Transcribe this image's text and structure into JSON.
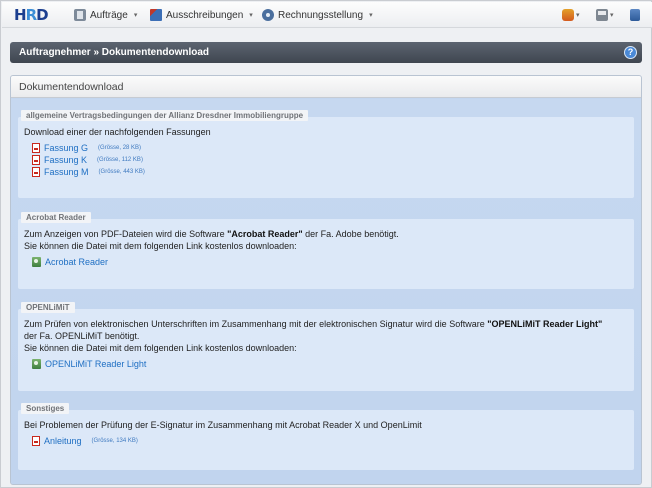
{
  "nav": {
    "logo": {
      "h": "H",
      "r": "R",
      "d": "D"
    },
    "items": [
      {
        "label": "Aufträge",
        "icon": "orders-icon"
      },
      {
        "label": "Ausschreibungen",
        "icon": "tender-icon"
      },
      {
        "label": "Rechnungsstellung",
        "icon": "billing-icon"
      }
    ],
    "caret": "▾",
    "right_icons": [
      "user-icon",
      "print-icon",
      "logout-icon"
    ]
  },
  "header": {
    "title": "Auftragnehmer » Dokumentendownload",
    "help": "?"
  },
  "panel": {
    "title": "Dokumentendownload",
    "sections": [
      {
        "legend": "allgemeine Vertragsbedingungen der Allianz Dresdner Immobiliengruppe",
        "text": "Download einer der nachfolgenden Fassungen",
        "links": [
          {
            "label": "Fassung G",
            "size": "(Grösse, 28 KB)"
          },
          {
            "label": "Fassung K",
            "size": "(Grösse, 112 KB)"
          },
          {
            "label": "Fassung M",
            "size": "(Grösse, 443 KB)"
          }
        ]
      },
      {
        "legend": "Acrobat Reader",
        "line1_pre": "Zum Anzeigen von PDF-Dateien wird die Software ",
        "line1_bold": "\"Acrobat Reader\"",
        "line1_post": " der Fa. Adobe benötigt.",
        "line2": "Sie können die Datei mit dem folgenden Link kostenlos downloaden:",
        "link": "Acrobat Reader"
      },
      {
        "legend": "OPENLiMiT",
        "line1_pre": "Zum Prüfen von elektronischen Unterschriften im Zusammenhang mit der elektronischen Signatur wird die Software ",
        "line1_bold": "\"OPENLiMiT Reader Light\"",
        "line2": "der Fa. OPENLiMiT benötigt.",
        "line3": "Sie können die Datei mit dem folgenden Link kostenlos downloaden:",
        "link": "OPENLiMiT Reader Light"
      },
      {
        "legend": "Sonstiges",
        "text": "Bei Problemen der Prüfung der E-Signatur im Zusammenhang mit Acrobat Reader X und OpenLimit",
        "link": {
          "label": "Anleitung",
          "size": "(Grösse, 134 KB)"
        }
      }
    ]
  }
}
